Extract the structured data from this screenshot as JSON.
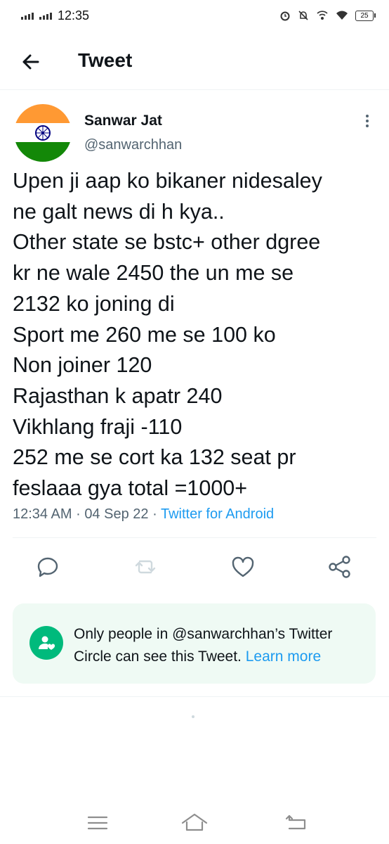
{
  "status_bar": {
    "time": "12:35",
    "battery": "25",
    "icons": [
      "signal-icon",
      "signal-icon",
      "alarm-icon",
      "mute-icon",
      "wifi-calling-icon",
      "wifi-icon",
      "battery-icon"
    ]
  },
  "header": {
    "title": "Tweet",
    "back_icon": "arrow-left-icon"
  },
  "tweet": {
    "author_name": "Sanwar Jat",
    "author_handle": "@sanwarchhan",
    "avatar": "indian-flag-avatar",
    "text": "Upen ji aap ko bikaner nidesaley\nne galt news di h kya..\nOther state se bstc+ other  dgree\nkr ne wale 2450 the un me se\n2132 ko joning di\nSport me 260 me se 100 ko\nNon joiner 120\nRajasthan k apatr 240\nVikhlang fraji -110\n252 me se cort ka 132 seat pr\nfeslaaa gya total =1000+",
    "time": "12:34 AM",
    "separator": "·",
    "date": "04 Sep 22",
    "source": "Twitter for Android"
  },
  "actions": [
    {
      "name": "reply",
      "icon": "reply-icon"
    },
    {
      "name": "retweet",
      "icon": "retweet-icon"
    },
    {
      "name": "like",
      "icon": "heart-icon"
    },
    {
      "name": "share",
      "icon": "share-icon"
    }
  ],
  "circle_notice": {
    "text": "Only people in @sanwarchhan’s Twitter Circle can see this Tweet.",
    "link": "Learn more",
    "icon": "twitter-circle-icon"
  },
  "colors": {
    "accent": "#1d9bf0",
    "circle_green": "#00ba7c",
    "circle_bg": "#effaf4",
    "secondary_text": "#536471"
  }
}
